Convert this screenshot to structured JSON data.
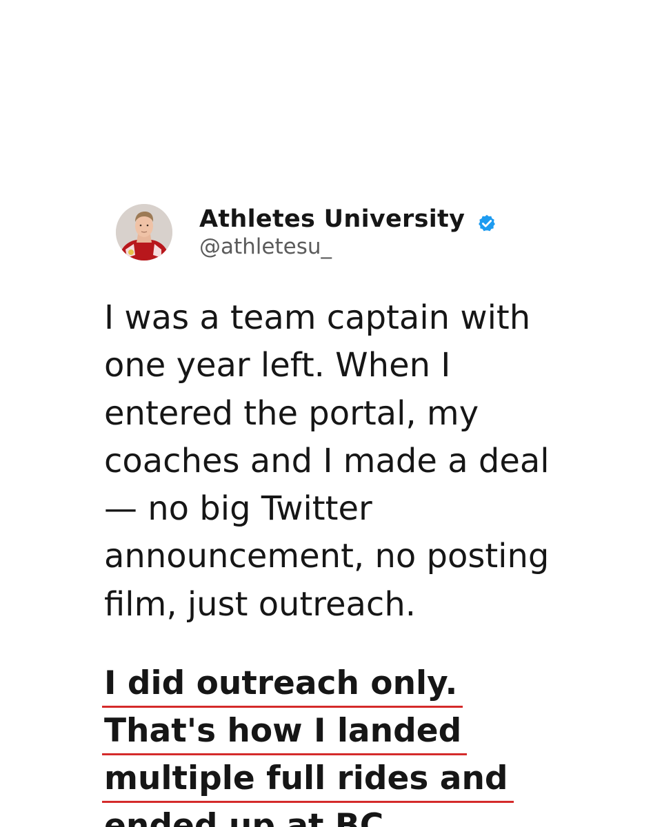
{
  "profile": {
    "display_name": "Athletes University",
    "handle": "@athletesu_",
    "verified": true,
    "verified_color": "#1d9bf0",
    "avatar_icon": "football-player-avatar"
  },
  "tweet": {
    "paragraph": "I was a team captain with one year left. When I entered the portal, my coaches and I made a deal — no big Twitter announcement, no posting film, just outreach.",
    "emphasis_lines": [
      "I did outreach only.",
      "That's how I landed",
      "multiple full rides and",
      "ended up at BC."
    ],
    "underline_color": "#d42a2a"
  }
}
